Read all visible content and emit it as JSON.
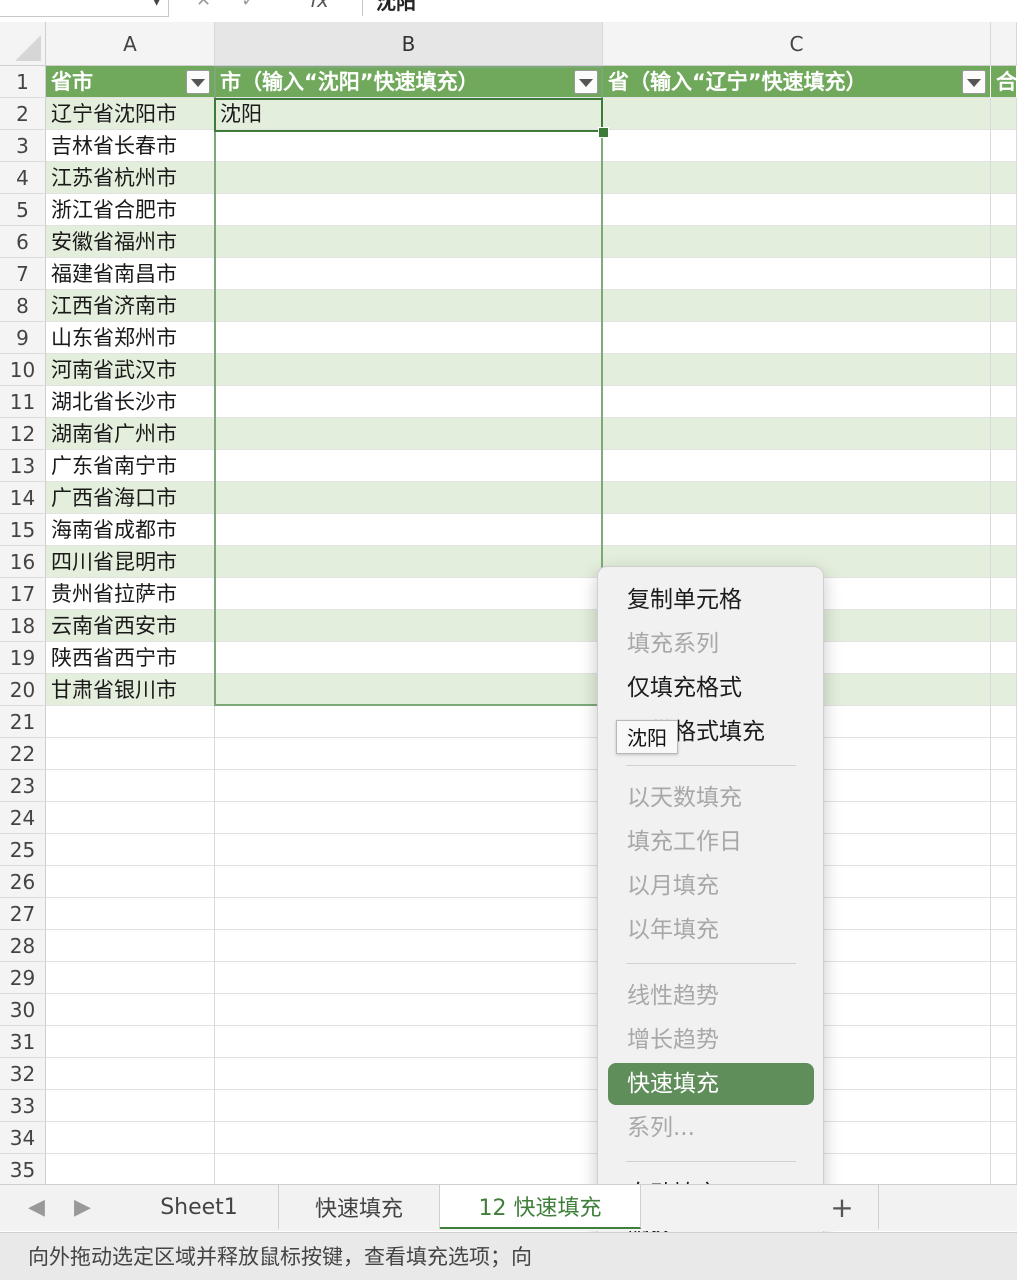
{
  "formula_bar": {
    "value": "沈阳",
    "fx": "fx"
  },
  "columns": [
    "A",
    "B",
    "C"
  ],
  "header_row": {
    "row_num": "1",
    "a": "省市",
    "b": "市（输入“沈阳”快速填充）",
    "c": "省（输入“辽宁”快速填充）",
    "d": "合"
  },
  "data_rows": [
    {
      "num": "2",
      "a": "辽宁省沈阳市",
      "b": "沈阳"
    },
    {
      "num": "3",
      "a": "吉林省长春市",
      "b": ""
    },
    {
      "num": "4",
      "a": "江苏省杭州市",
      "b": ""
    },
    {
      "num": "5",
      "a": "浙江省合肥市",
      "b": ""
    },
    {
      "num": "6",
      "a": "安徽省福州市",
      "b": ""
    },
    {
      "num": "7",
      "a": "福建省南昌市",
      "b": ""
    },
    {
      "num": "8",
      "a": "江西省济南市",
      "b": ""
    },
    {
      "num": "9",
      "a": "山东省郑州市",
      "b": ""
    },
    {
      "num": "10",
      "a": "河南省武汉市",
      "b": ""
    },
    {
      "num": "11",
      "a": "湖北省长沙市",
      "b": ""
    },
    {
      "num": "12",
      "a": "湖南省广州市",
      "b": ""
    },
    {
      "num": "13",
      "a": "广东省南宁市",
      "b": ""
    },
    {
      "num": "14",
      "a": "广西省海口市",
      "b": ""
    },
    {
      "num": "15",
      "a": "海南省成都市",
      "b": ""
    },
    {
      "num": "16",
      "a": "四川省昆明市",
      "b": ""
    },
    {
      "num": "17",
      "a": "贵州省拉萨市",
      "b": ""
    },
    {
      "num": "18",
      "a": "云南省西安市",
      "b": ""
    },
    {
      "num": "19",
      "a": "陕西省西宁市",
      "b": ""
    },
    {
      "num": "20",
      "a": "甘肃省银川市",
      "b": ""
    }
  ],
  "empty_rows": [
    "21",
    "22",
    "23",
    "24",
    "25",
    "26",
    "27",
    "28",
    "29",
    "30",
    "31",
    "32",
    "33",
    "34",
    "35"
  ],
  "context_menu": {
    "items": [
      {
        "label": "复制单元格",
        "disabled": false
      },
      {
        "label": "填充系列",
        "disabled": true
      },
      {
        "label": "仅填充格式",
        "disabled": false
      },
      {
        "label": "不带格式填充",
        "disabled": false
      },
      {
        "label": "以天数填充",
        "disabled": true
      },
      {
        "label": "填充工作日",
        "disabled": true
      },
      {
        "label": "以月填充",
        "disabled": true
      },
      {
        "label": "以年填充",
        "disabled": true
      },
      {
        "label": "线性趋势",
        "disabled": true
      },
      {
        "label": "增长趋势",
        "disabled": true
      },
      {
        "label": "快速填充",
        "disabled": false,
        "highlighted": true
      },
      {
        "label": "系列...",
        "disabled": true
      },
      {
        "label": "自动填充",
        "disabled": false,
        "submenu": true
      },
      {
        "label": "服务",
        "disabled": false,
        "submenu": true
      }
    ],
    "submenu_glyph": "›"
  },
  "tooltip": "沈阳",
  "sheet_tabs": [
    {
      "label": "Sheet1",
      "active": false
    },
    {
      "label": "快速填充",
      "active": false
    },
    {
      "label": "12 快速填充",
      "active": true
    }
  ],
  "add_tab": "+",
  "status_text": "向外拖动选定区域并释放鼠标按键，查看填充选项；向",
  "colors": {
    "header_green": "#70a85c",
    "band_green": "#e4eedc",
    "highlight": "#5f8e5a",
    "active_tab": "#3f7f3a"
  }
}
